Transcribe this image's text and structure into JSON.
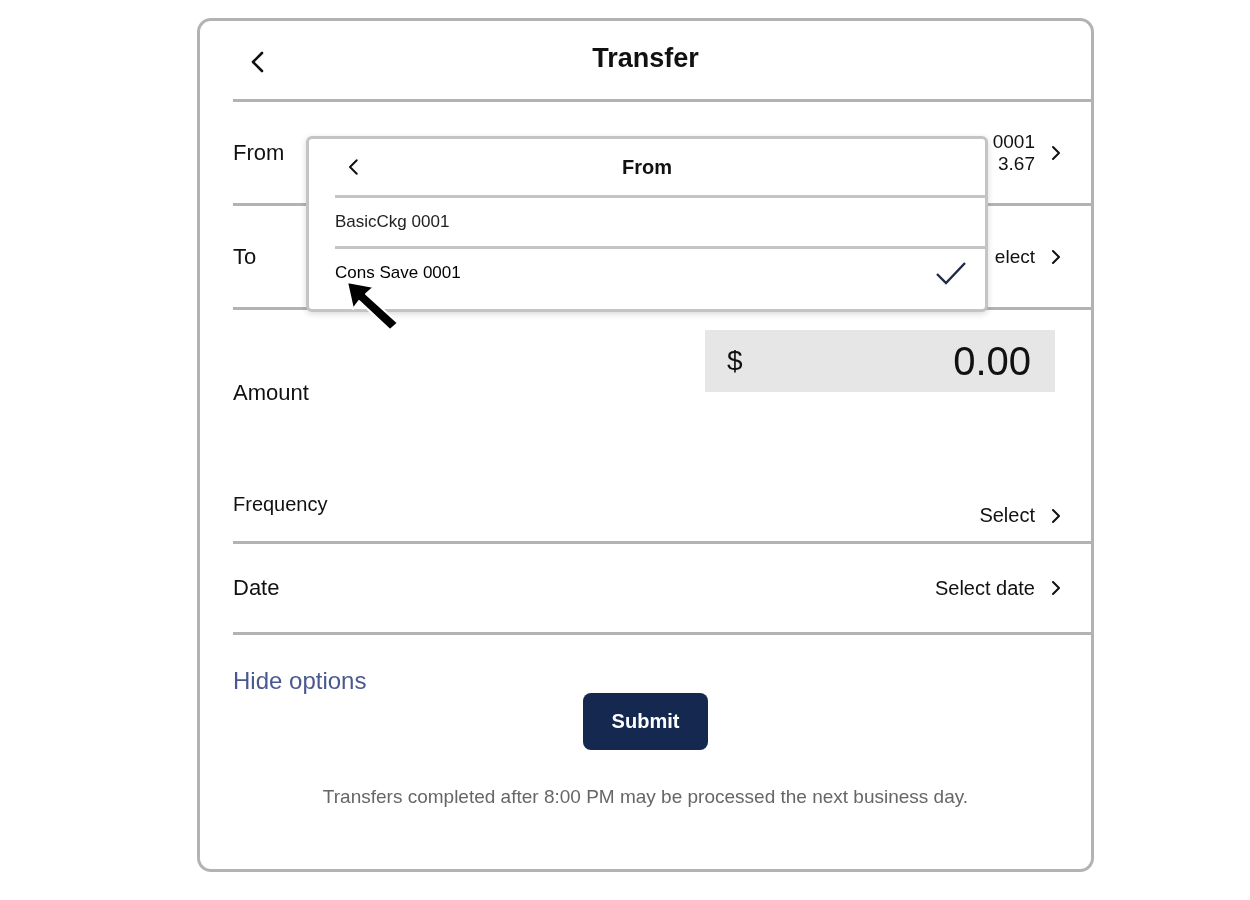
{
  "header": {
    "title": "Transfer"
  },
  "fields": [
    {
      "label": "From",
      "values": [
        "0001",
        "3.67"
      ]
    },
    {
      "label": "To",
      "values": [
        "elect"
      ]
    }
  ],
  "amount": {
    "label": "Amount",
    "currency": "$",
    "value": "0.00"
  },
  "options": [
    {
      "label": "Frequency",
      "value": "Select"
    },
    {
      "label": "Date",
      "value": "Select date"
    }
  ],
  "hide_options": "Hide options",
  "submit": "Submit",
  "note": "Transfers completed after 8:00 PM may be processed the next business day.",
  "popup": {
    "title": "From",
    "items": [
      {
        "label": "BasicCkg 0001",
        "selected": false
      },
      {
        "label": "Cons Save 0001",
        "selected": true
      }
    ]
  }
}
